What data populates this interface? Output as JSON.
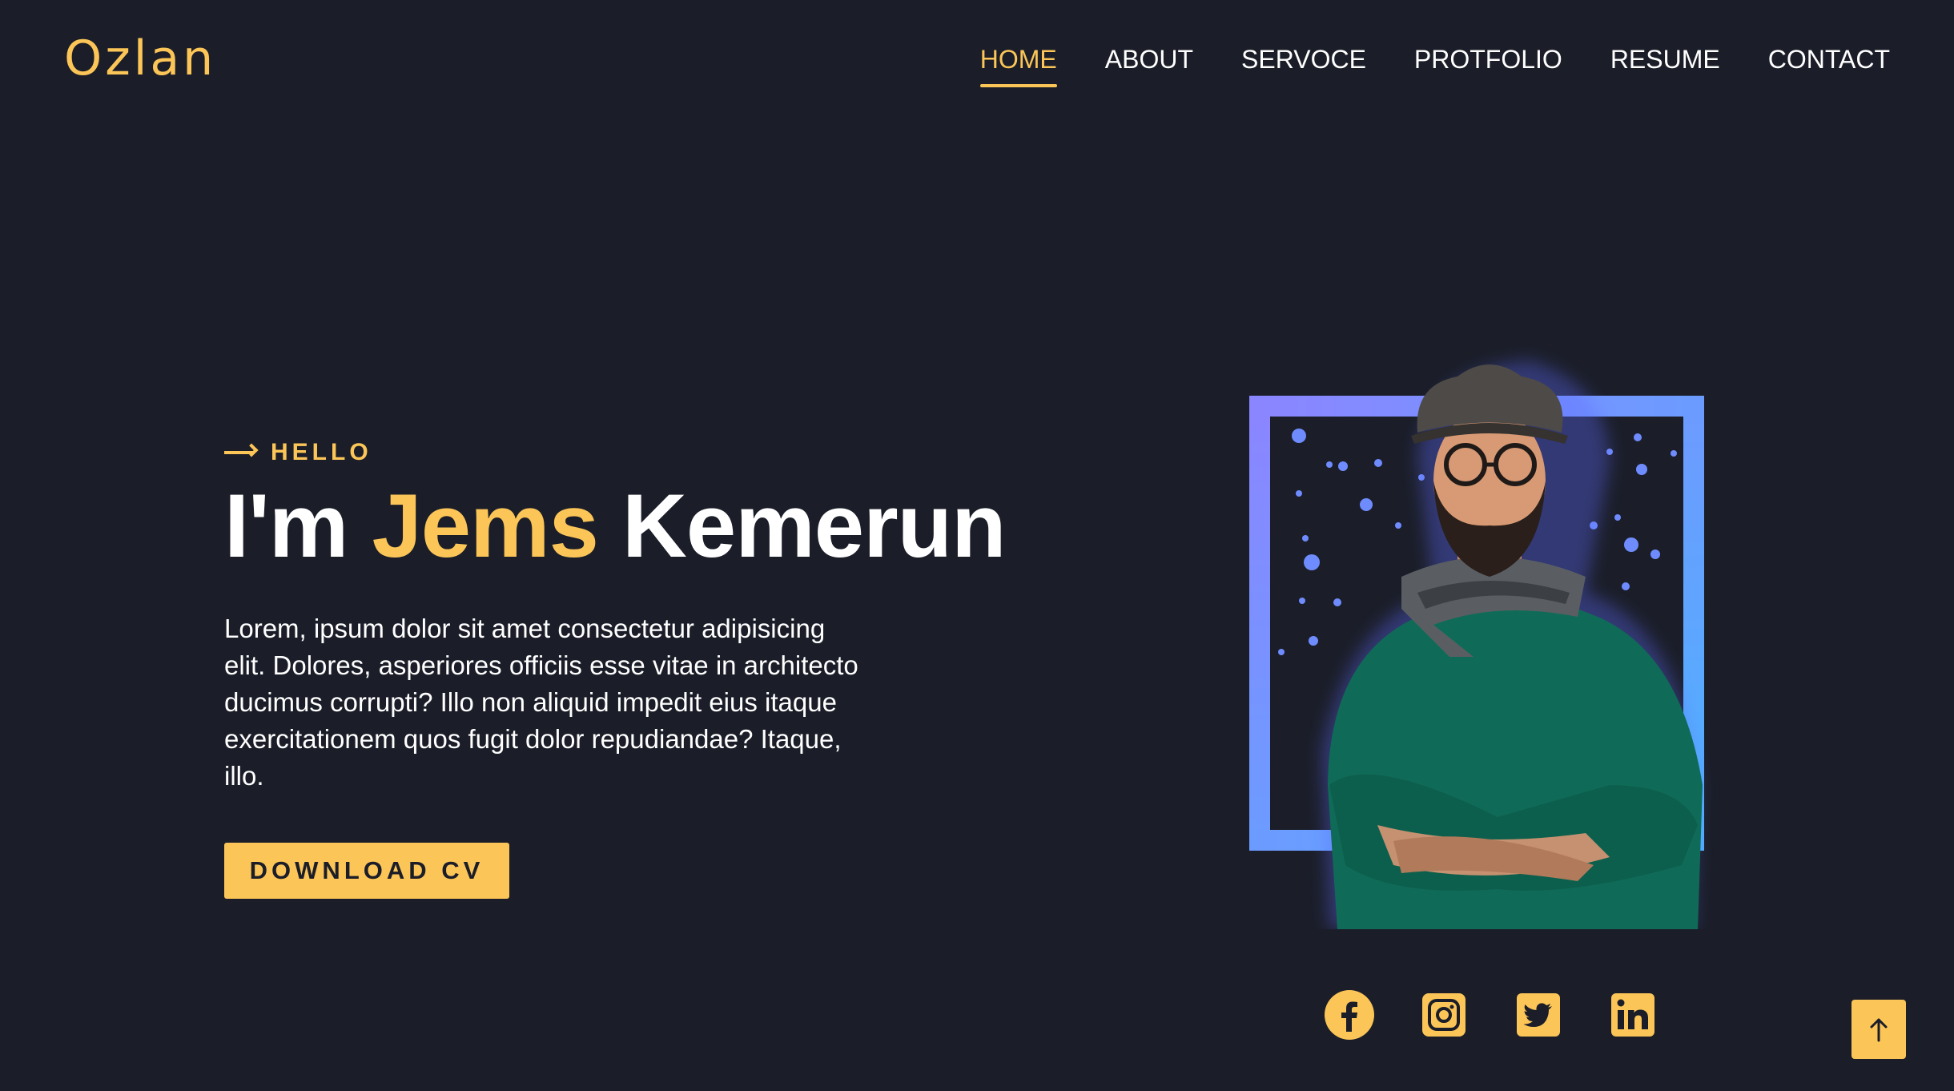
{
  "header": {
    "logo": "Ozlan",
    "nav": [
      {
        "label": "HOME",
        "active": true
      },
      {
        "label": "ABOUT"
      },
      {
        "label": "SERVOCE"
      },
      {
        "label": "PROTFOLIO"
      },
      {
        "label": "RESUME"
      },
      {
        "label": "CONTACT"
      }
    ]
  },
  "hero": {
    "greeting": "HELLO",
    "name_prefix": "I'm ",
    "name_first": "Jems",
    "name_last": " Kemerun",
    "bio": "Lorem, ipsum dolor sit amet consectetur adipisicing elit. Dolores, asperiores officiis esse vitae in architecto ducimus corrupti? Illo non aliquid impedit eius itaque exercitationem quos fugit dolor repudiandae? Itaque, illo.",
    "cta": "DOWNLOAD CV"
  },
  "social": {
    "icons": [
      "facebook-icon",
      "instagram-icon",
      "twitter-icon",
      "linkedin-icon"
    ]
  },
  "colors": {
    "background": "#1b1e29",
    "accent": "#fcc557",
    "frame_start": "#8a86ff",
    "frame_end": "#4fb0ff",
    "sweater": "#0f6b57"
  }
}
